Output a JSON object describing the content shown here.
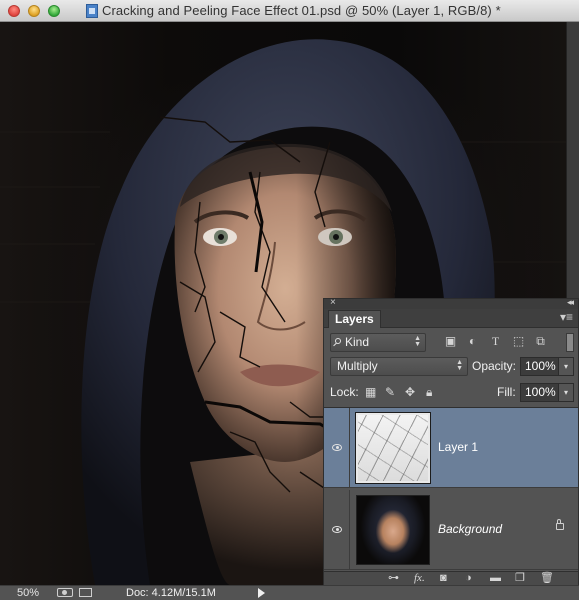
{
  "window": {
    "title": "Cracking and Peeling Face Effect 01.psd @ 50% (Layer 1, RGB/8) *"
  },
  "status_bar": {
    "zoom": "50%",
    "doc_info": "Doc: 4.12M/15.1M"
  },
  "layers_panel": {
    "tab_label": "Layers",
    "filter_kind": "Kind",
    "blend_mode": "Multiply",
    "opacity_label": "Opacity:",
    "opacity_value": "100%",
    "lock_label": "Lock:",
    "fill_label": "Fill:",
    "fill_value": "100%",
    "filter_icons": [
      "pixel-filter-icon",
      "adjustment-filter-icon",
      "type-filter-icon",
      "shape-filter-icon",
      "smart-object-filter-icon"
    ],
    "lock_icons": [
      "lock-transparent-icon",
      "lock-image-icon",
      "lock-position-icon",
      "lock-all-icon"
    ],
    "layers": [
      {
        "name": "Layer 1",
        "visible": true,
        "selected": true
      },
      {
        "name": "Background",
        "visible": true,
        "selected": false,
        "locked": true
      }
    ],
    "footer_icons": [
      "link-layers-icon",
      "fx-icon",
      "add-mask-icon",
      "adjustment-layer-icon",
      "new-group-icon",
      "new-layer-icon",
      "trash-icon"
    ]
  },
  "colors": {
    "panel_bg": "#535353",
    "selected_layer": "#6b7f99",
    "status_bar": "#535353"
  }
}
